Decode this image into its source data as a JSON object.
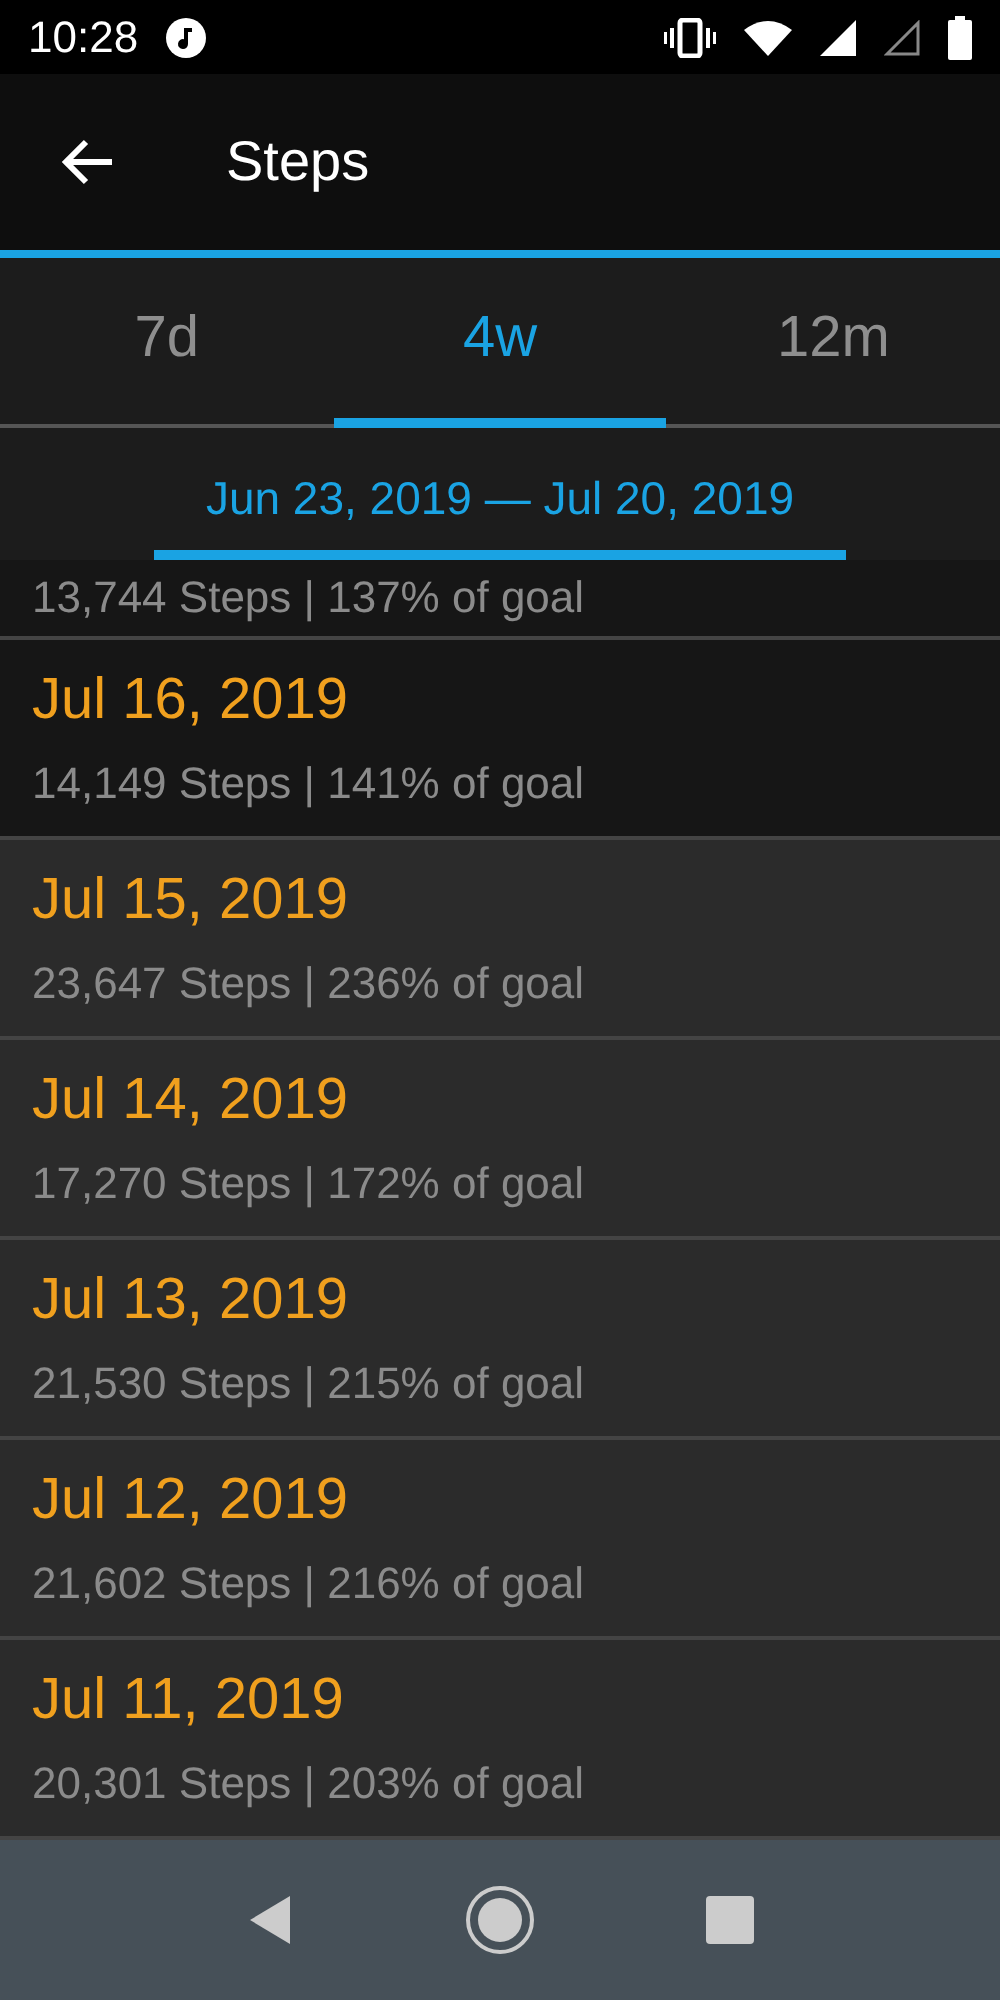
{
  "status_bar": {
    "time": "10:28"
  },
  "app_bar": {
    "title": "Steps"
  },
  "tabs": [
    {
      "label": "7d",
      "selected": false
    },
    {
      "label": "4w",
      "selected": true
    },
    {
      "label": "12m",
      "selected": false
    }
  ],
  "range": {
    "label": "Jun 23, 2019 — Jul 20, 2019"
  },
  "rows": [
    {
      "steps": "13,744 Steps | 137% of goal",
      "selected": true
    },
    {
      "date": "Jul 16, 2019",
      "steps": "14,149 Steps | 141% of goal",
      "selected": true
    },
    {
      "date": "Jul 15, 2019",
      "steps": "23,647 Steps | 236% of goal",
      "selected": false
    },
    {
      "date": "Jul 14, 2019",
      "steps": "17,270 Steps | 172% of goal",
      "selected": false
    },
    {
      "date": "Jul 13, 2019",
      "steps": "21,530 Steps | 215% of goal",
      "selected": false
    },
    {
      "date": "Jul 12, 2019",
      "steps": "21,602 Steps | 216% of goal",
      "selected": false
    },
    {
      "date": "Jul 11, 2019",
      "steps": "20,301 Steps | 203% of goal",
      "selected": false
    }
  ]
}
